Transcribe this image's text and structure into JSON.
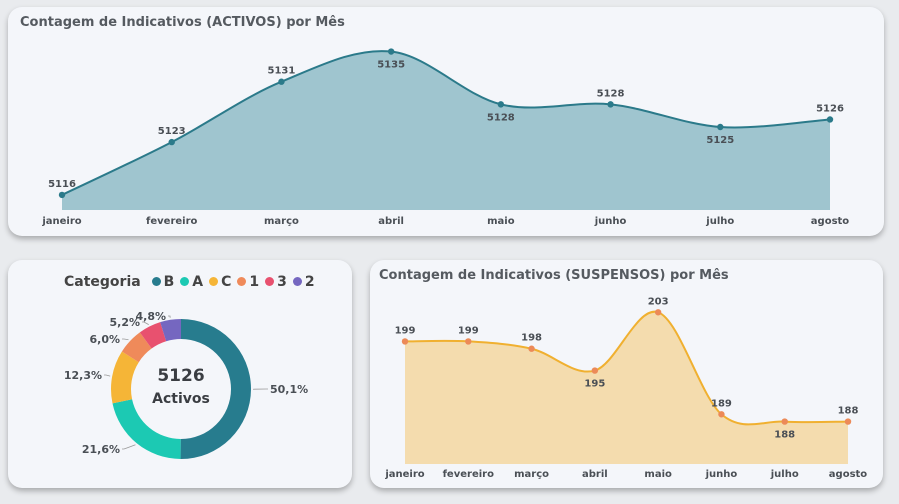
{
  "colors": {
    "activos_line": "#2b7a8a",
    "activos_fill": "#9fc5cf",
    "susp_line": "#f0b030",
    "susp_fill": "#f4dcae",
    "susp_marker": "#ec8a58",
    "cat_B": "#277c8e",
    "cat_A": "#1cc9b3",
    "cat_C": "#f5b537",
    "cat_1": "#ef8a5a",
    "cat_3": "#e8516f",
    "cat_2": "#7567c0"
  },
  "chart_data": [
    {
      "type": "area",
      "title": "Contagem de Indicativos (ACTIVOS) por Mês",
      "categories": [
        "janeiro",
        "fevereiro",
        "março",
        "abril",
        "maio",
        "junho",
        "julho",
        "agosto"
      ],
      "values": [
        5116,
        5123,
        5131,
        5135,
        5128,
        5128,
        5125,
        5126
      ],
      "labels": [
        "5116",
        "5123",
        "5131",
        "5135",
        "5128",
        "5128",
        "5125",
        "5126"
      ],
      "ylim": [
        5114,
        5136
      ],
      "xlabel": "",
      "ylabel": ""
    },
    {
      "type": "pie",
      "legend_title": "Categoria",
      "categories": [
        "B",
        "A",
        "C",
        "1",
        "3",
        "2"
      ],
      "values": [
        50.1,
        21.6,
        12.3,
        6.0,
        5.2,
        4.8
      ],
      "labels": [
        "50,1%",
        "21,6%",
        "12,3%",
        "6,0%",
        "5,2%",
        "4,8%"
      ],
      "center_value": "5126",
      "center_label": "Activos",
      "legend": "top"
    },
    {
      "type": "area",
      "title": "Contagem de Indicativos (SUSPENSOS) por Mês",
      "categories": [
        "janeiro",
        "fevereiro",
        "março",
        "abril",
        "maio",
        "junho",
        "julho",
        "agosto"
      ],
      "values": [
        199,
        199,
        198,
        195,
        203,
        189,
        188,
        188
      ],
      "labels": [
        "199",
        "199",
        "198",
        "195",
        "203",
        "189",
        "188",
        "188"
      ],
      "ylim": [
        183,
        204
      ],
      "xlabel": "",
      "ylabel": ""
    }
  ]
}
